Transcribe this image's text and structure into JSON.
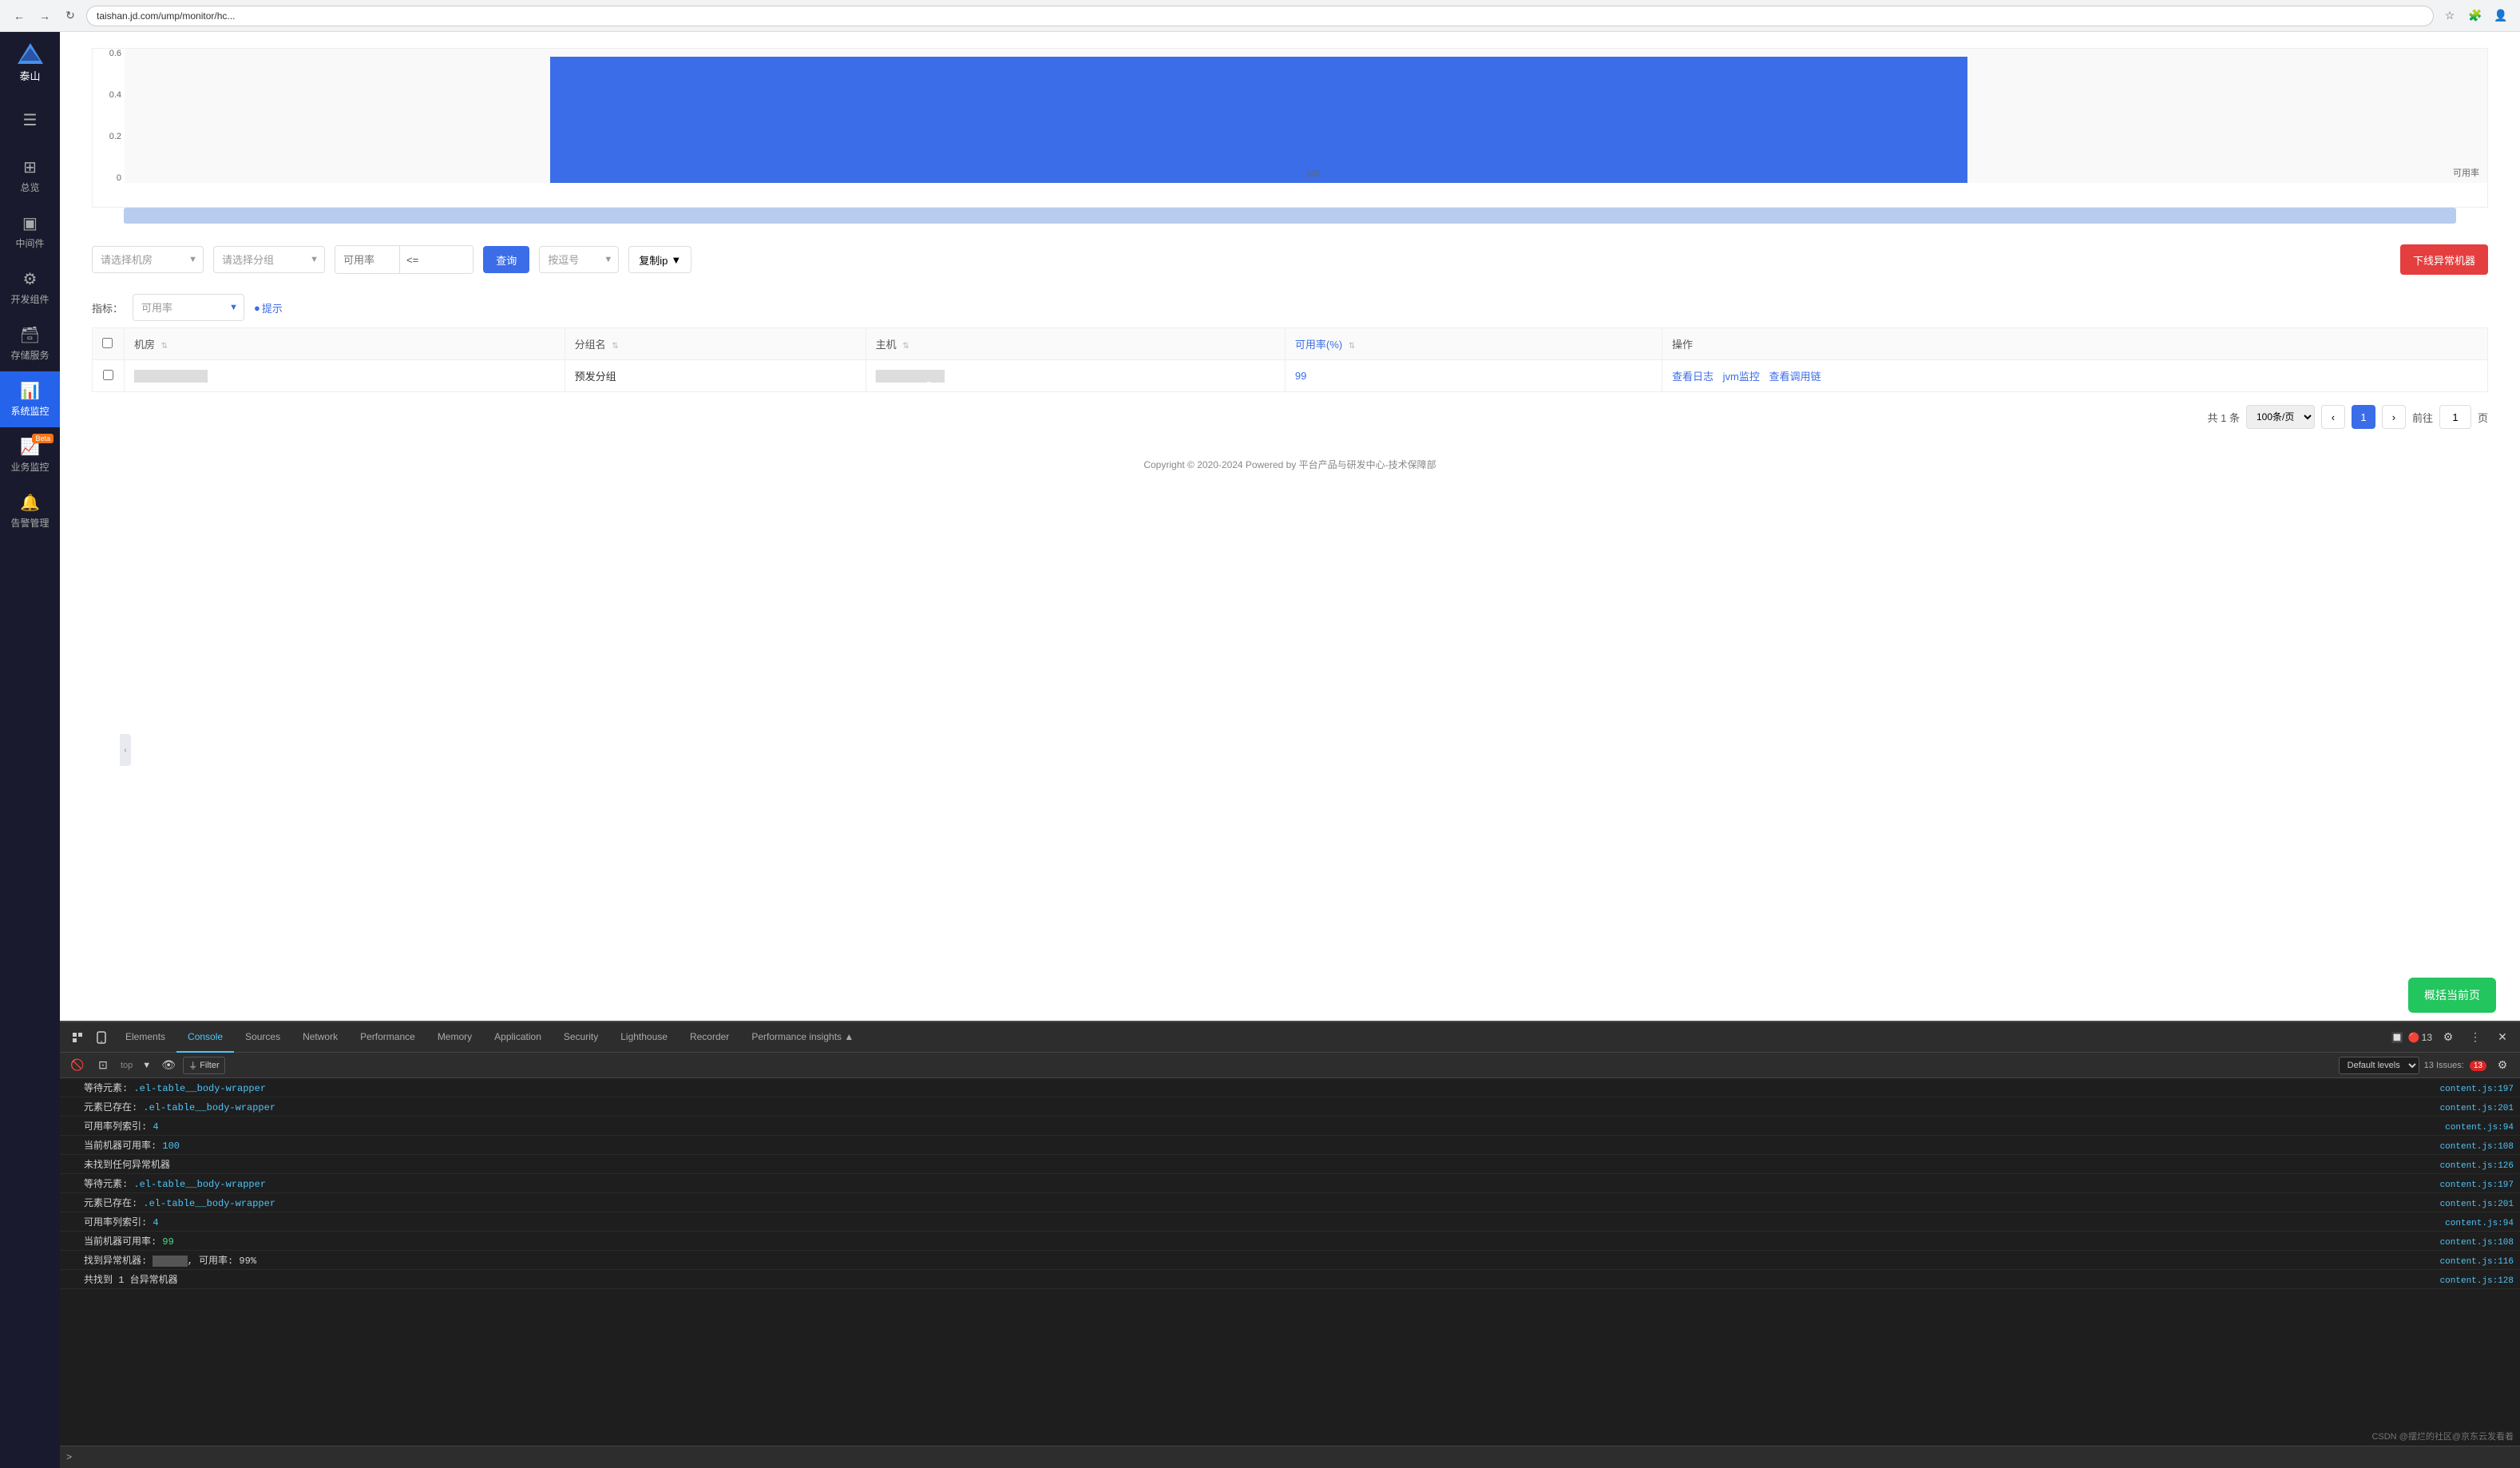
{
  "browser": {
    "url": "taishan.jd.com/ump/monitor/hc...",
    "back_label": "←",
    "forward_label": "→",
    "refresh_label": "↻"
  },
  "sidebar": {
    "logo_text": "泰山",
    "items": [
      {
        "id": "menu",
        "label": "",
        "icon": "☰"
      },
      {
        "id": "overview",
        "label": "总览",
        "icon": "⊞"
      },
      {
        "id": "middleware",
        "label": "中间件",
        "icon": "▣"
      },
      {
        "id": "devtools",
        "label": "开发组件",
        "icon": "⚙"
      },
      {
        "id": "storage",
        "label": "存储服务",
        "icon": "🗃"
      },
      {
        "id": "sysmon",
        "label": "系统监控",
        "icon": "📊",
        "active": true
      },
      {
        "id": "bizmon",
        "label": "业务监控",
        "icon": "📈",
        "beta": true
      },
      {
        "id": "alert",
        "label": "告警管理",
        "icon": "🔔"
      }
    ]
  },
  "chart": {
    "y_labels": [
      "0.6",
      "0.4",
      "0.2",
      "0"
    ],
    "x_label": "可用率",
    "x_value": "100"
  },
  "filter": {
    "datacenter_placeholder": "请选择机房",
    "group_placeholder": "请选择分组",
    "metric_placeholder": "可用率",
    "operator": "<=",
    "query_btn": "查询",
    "sort_label": "按逗号",
    "copy_label": "复制ip",
    "offline_btn": "下线异常机器"
  },
  "metrics": {
    "label": "指标：",
    "value": "可用率",
    "hint_label": "●提示"
  },
  "table": {
    "columns": [
      {
        "id": "datacenter",
        "label": "机房"
      },
      {
        "id": "group",
        "label": "分组名"
      },
      {
        "id": "host",
        "label": "主机"
      },
      {
        "id": "availability",
        "label": "可用率(%)"
      },
      {
        "id": "actions",
        "label": "操作"
      }
    ],
    "rows": [
      {
        "datacenter": "██████████",
        "group": "预发分组",
        "host": "███████ ██",
        "availability": "99",
        "actions": [
          "查看日志",
          "jvm监控",
          "查看调用链"
        ]
      }
    ]
  },
  "pagination": {
    "total_text": "共 1 条",
    "page_size": "100条/页",
    "current_page": "1",
    "goto_label": "前往",
    "page_label": "页"
  },
  "footer": {
    "copyright": "Copyright © 2020-2024 Powered by 平台产品与研发中心-技术保障部"
  },
  "summary_btn": "概括当前页",
  "devtools": {
    "tabs": [
      {
        "id": "elements",
        "label": "Elements"
      },
      {
        "id": "console",
        "label": "Console",
        "active": true
      },
      {
        "id": "sources",
        "label": "Sources"
      },
      {
        "id": "network",
        "label": "Network"
      },
      {
        "id": "performance",
        "label": "Performance"
      },
      {
        "id": "memory",
        "label": "Memory"
      },
      {
        "id": "application",
        "label": "Application"
      },
      {
        "id": "security",
        "label": "Security"
      },
      {
        "id": "lighthouse",
        "label": "Lighthouse"
      },
      {
        "id": "recorder",
        "label": "Recorder"
      },
      {
        "id": "perf_insights",
        "label": "Performance insights ▲"
      }
    ],
    "issues_count": "13",
    "console_toolbar": {
      "level_select": "Default levels",
      "filter_label": "Filter",
      "issues_label": "13 Issues:",
      "issues_count": "13"
    },
    "log_lines": [
      {
        "text": "等待元素: .el-table__body-wrapper",
        "source": "content.js:197"
      },
      {
        "text": "元素已存在: .el-table__body-wrapper",
        "source": "content.js:201"
      },
      {
        "text": "可用率列索引: 4",
        "highlight": "4",
        "source": "content.js:94"
      },
      {
        "text": "当前机器可用率: 100",
        "highlight": "100",
        "source": "content.js:108"
      },
      {
        "text": "未找到任何异常机器",
        "source": "content.js:126"
      },
      {
        "text": "等待元素: .el-table__body-wrapper",
        "source": "content.js:197"
      },
      {
        "text": "元素已存在: .el-table__body-wrapper",
        "source": "content.js:201"
      },
      {
        "text": "可用率列索引: 4",
        "highlight": "4",
        "source": "content.js:94"
      },
      {
        "text": "当前机器可用率: 99",
        "highlight": "99",
        "source": "content.js:108"
      },
      {
        "text": "找到异常机器: ███ ██, 可用率: 99%",
        "source": "content.js:116"
      },
      {
        "text": "共找到 1 台异常机器",
        "source": "content.js:128"
      }
    ],
    "watermark": "CSDN @摆烂的社区@京东云发看着",
    "console_prompt": ">",
    "top_label": "top"
  }
}
